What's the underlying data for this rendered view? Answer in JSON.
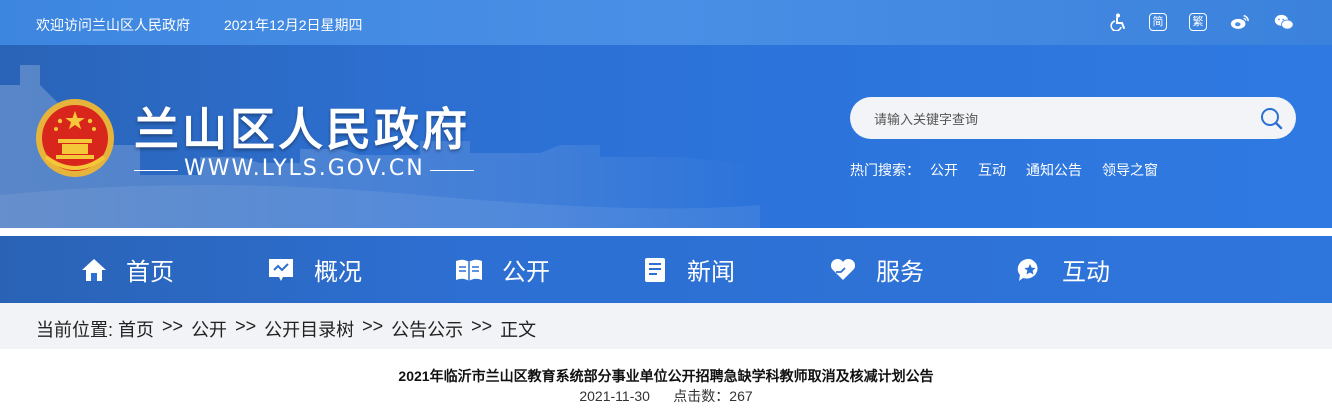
{
  "topbar": {
    "welcome": "欢迎访问兰山区人民政府",
    "date": "2021年12月2日星期四",
    "icons": {
      "accessibility": "accessibility-icon",
      "simplified_label": "简",
      "traditional_label": "繁",
      "weibo": "weibo-icon",
      "wechat": "wechat-icon"
    }
  },
  "header": {
    "site_title": "兰山区人民政府",
    "site_url": "WWW.LYLS.GOV.CN",
    "search_placeholder": "请输入关键字查询",
    "hot_label": "热门搜索：",
    "hot_keywords": [
      "公开",
      "互动",
      "通知公告",
      "领导之窗"
    ]
  },
  "nav": {
    "items": [
      {
        "label": "首页",
        "icon": "home-icon"
      },
      {
        "label": "概况",
        "icon": "overview-icon"
      },
      {
        "label": "公开",
        "icon": "open-book-icon"
      },
      {
        "label": "新闻",
        "icon": "news-icon"
      },
      {
        "label": "服务",
        "icon": "heart-hand-icon"
      },
      {
        "label": "互动",
        "icon": "chat-star-icon"
      }
    ]
  },
  "breadcrumb": {
    "prefix": "当前位置:",
    "items": [
      "首页",
      "公开",
      "公开目录树",
      "公告公示",
      "正文"
    ],
    "separator": ">>"
  },
  "article": {
    "title": "2021年临沂市兰山区教育系统部分事业单位公开招聘急缺学科教师取消及核减计划公告",
    "date": "2021-11-30",
    "hits_label": "点击数：",
    "hits": "267"
  },
  "colors": {
    "topbar": "#4a8fe6",
    "banner": "#2c74dc",
    "nav": "#2d6fd2",
    "crumb_bg": "#f1f3f6"
  }
}
